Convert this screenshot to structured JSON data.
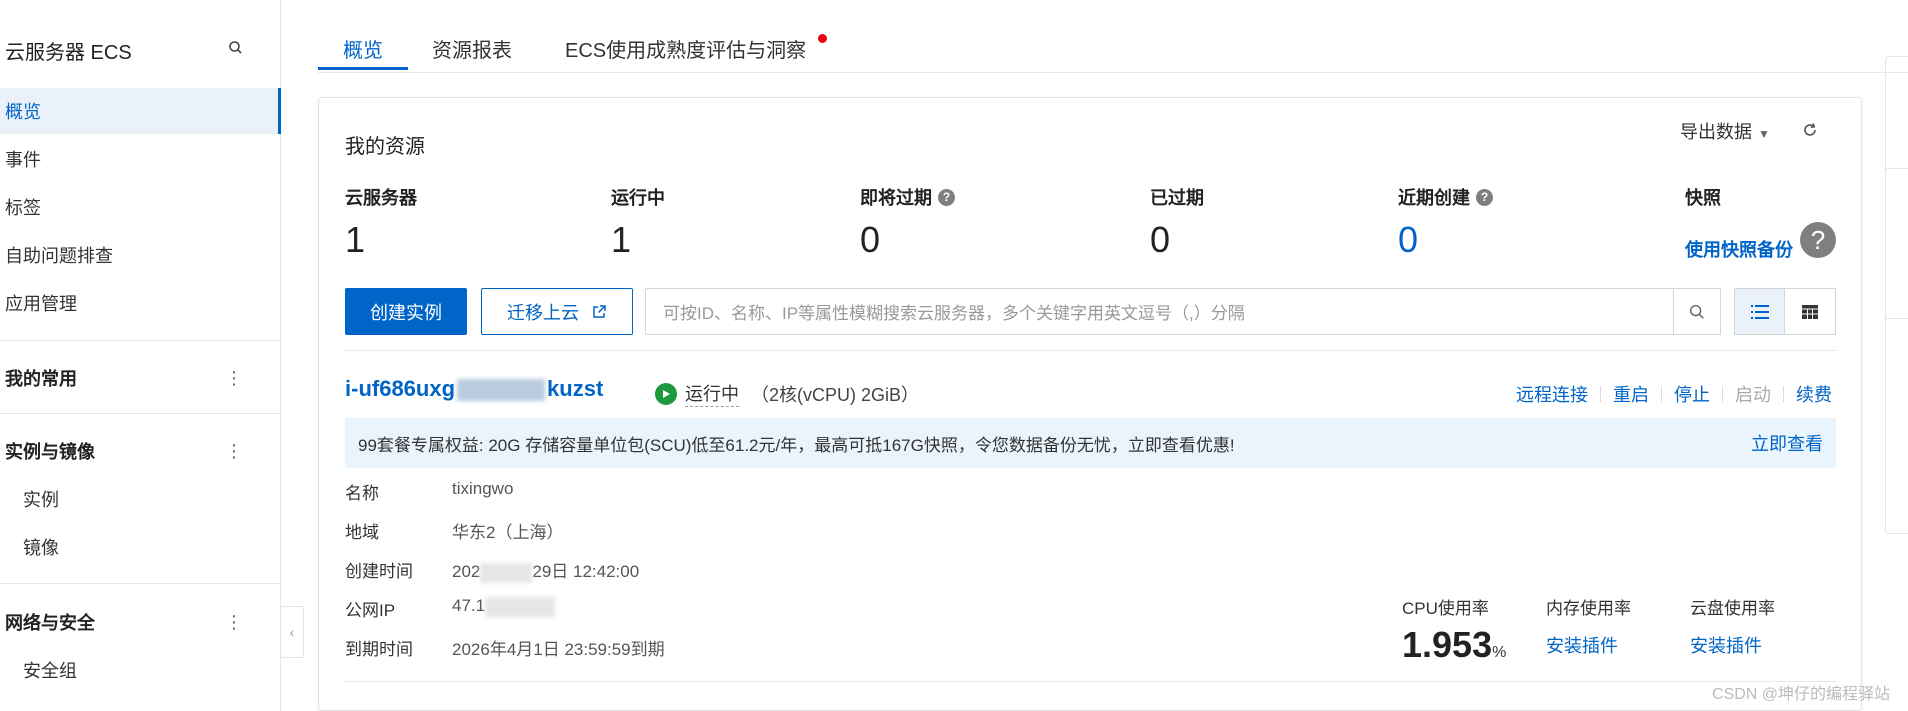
{
  "sidebar": {
    "title": "云服务器 ECS",
    "items": [
      {
        "label": "概览"
      },
      {
        "label": "事件"
      },
      {
        "label": "标签"
      },
      {
        "label": "自助问题排查"
      },
      {
        "label": "应用管理"
      }
    ],
    "groups": [
      {
        "label": "我的常用",
        "items": []
      },
      {
        "label": "实例与镜像",
        "items": [
          {
            "label": "实例"
          },
          {
            "label": "镜像"
          }
        ]
      },
      {
        "label": "网络与安全",
        "items": [
          {
            "label": "安全组"
          }
        ]
      }
    ]
  },
  "tabs": [
    {
      "label": "概览"
    },
    {
      "label": "资源报表"
    },
    {
      "label": "ECS使用成熟度评估与洞察"
    }
  ],
  "resources": {
    "title": "我的资源",
    "export_label": "导出数据",
    "stats": [
      {
        "label": "云服务器",
        "value": "1"
      },
      {
        "label": "运行中",
        "value": "1"
      },
      {
        "label": "即将过期",
        "value": "0"
      },
      {
        "label": "已过期",
        "value": "0"
      },
      {
        "label": "近期创建",
        "value": "0"
      },
      {
        "label": "快照",
        "value": "使用快照备份"
      }
    ]
  },
  "toolbar": {
    "create_label": "创建实例",
    "migrate_label": "迁移上云",
    "search_placeholder": "可按ID、名称、IP等属性模糊搜索云服务器，多个关键字用英文逗号（,）分隔"
  },
  "instance": {
    "id_prefix": "i-uf686uxg",
    "id_suffix": "kuzst",
    "status": "运行中",
    "spec": "（2核(vCPU) 2GiB）",
    "actions": [
      {
        "label": "远程连接",
        "enabled": true
      },
      {
        "label": "重启",
        "enabled": true
      },
      {
        "label": "停止",
        "enabled": true
      },
      {
        "label": "启动",
        "enabled": false
      },
      {
        "label": "续费",
        "enabled": true
      }
    ],
    "promo_text": "99套餐专属权益: 20G 存储容量单位包(SCU)低至61.2元/年，最高可抵167G快照，令您数据备份无忧，立即查看优惠!",
    "promo_link": "立即查看",
    "details": {
      "name_label": "名称",
      "name_value": "tixingwo",
      "region_label": "地域",
      "region_value": "华东2（上海）",
      "created_label": "创建时间",
      "created_prefix": "202",
      "created_suffix": "29日 12:42:00",
      "ip_label": "公网IP",
      "ip_prefix": "47.1",
      "expire_label": "到期时间",
      "expire_value": "2026年4月1日 23:59:59到期"
    },
    "metrics": {
      "cpu_label": "CPU使用率",
      "cpu_value": "1.953",
      "cpu_unit": "%",
      "mem_label": "内存使用率",
      "mem_link": "安装插件",
      "disk_label": "云盘使用率",
      "disk_link": "安装插件"
    }
  },
  "watermark": "CSDN @坤仔的编程驿站",
  "colors": {
    "accent": "#0064c8",
    "running": "#1e9a3e",
    "notify": "#e60012"
  }
}
